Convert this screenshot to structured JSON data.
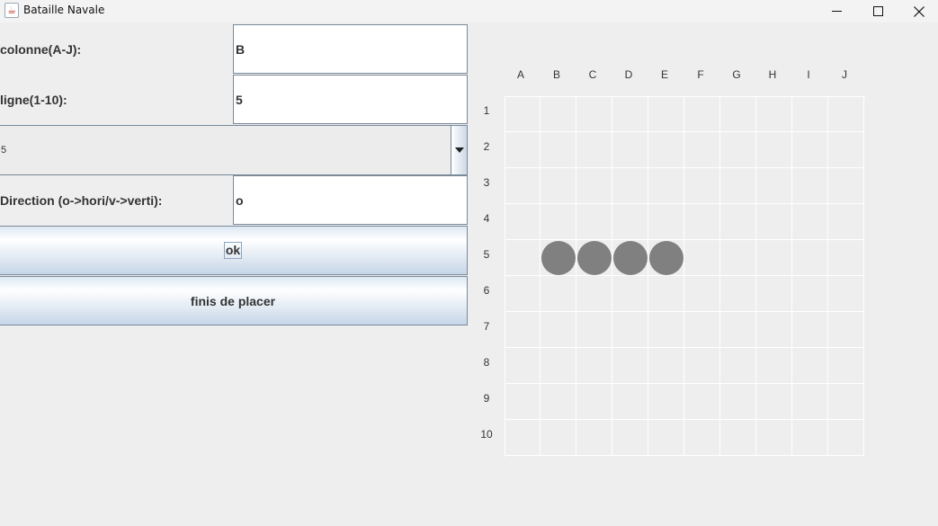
{
  "window": {
    "title": "Bataille Navale"
  },
  "form": {
    "colonne_label": "colonne(A-J):",
    "colonne_value": "B",
    "ligne_label": "ligne(1-10):",
    "ligne_value": "5",
    "ship_size_selected": "5",
    "direction_label": "Direction (o->hori/v->verti):",
    "direction_value": "o",
    "ok_label": "ok",
    "finish_label": "finis de placer"
  },
  "grid": {
    "columns": [
      "A",
      "B",
      "C",
      "D",
      "E",
      "F",
      "G",
      "H",
      "I",
      "J"
    ],
    "rows": [
      "1",
      "2",
      "3",
      "4",
      "5",
      "6",
      "7",
      "8",
      "9",
      "10"
    ],
    "ships": [
      {
        "col": "B",
        "row": "5"
      },
      {
        "col": "C",
        "row": "5"
      },
      {
        "col": "D",
        "row": "5"
      },
      {
        "col": "E",
        "row": "5"
      }
    ],
    "ship_color": "#808080"
  }
}
